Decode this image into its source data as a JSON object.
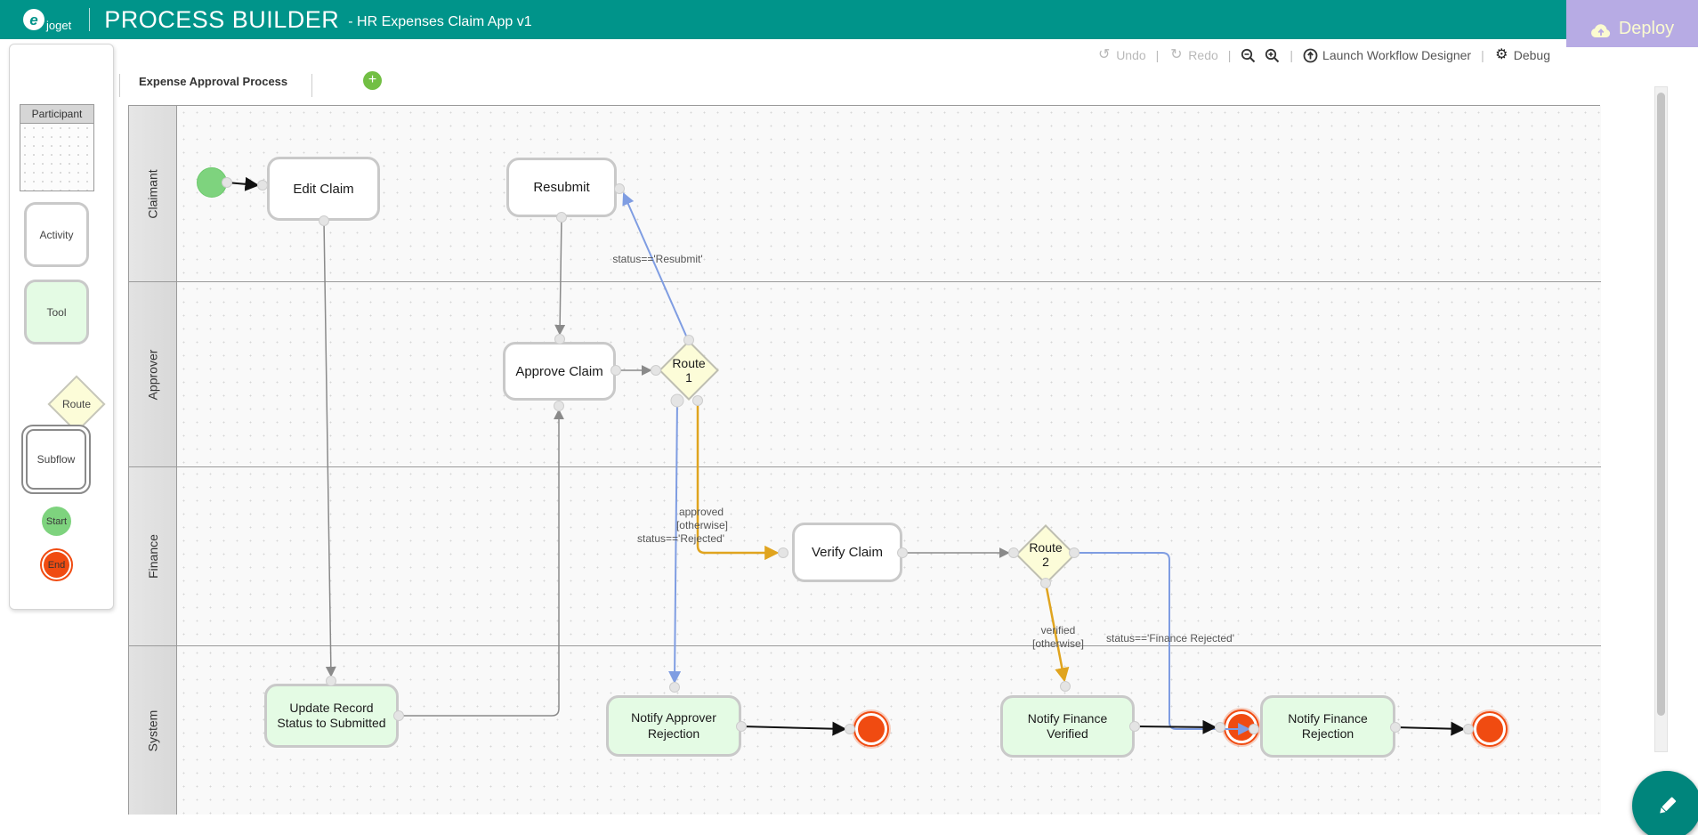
{
  "header": {
    "brand": "joget",
    "brand_mark": "e",
    "product": "PROCESS BUILDER",
    "app": "- HR Expenses Claim App v1"
  },
  "toolbar": {
    "undo": "Undo",
    "redo": "Redo",
    "launch": "Launch Workflow Designer",
    "debug": "Debug",
    "deploy": "Deploy",
    "separator": "|"
  },
  "tabs": {
    "active": "Expense Approval Process",
    "add": "+"
  },
  "palette": {
    "participant": "Participant",
    "activity": "Activity",
    "tool": "Tool",
    "route": "Route",
    "subflow": "Subflow",
    "start": "Start",
    "end": "End"
  },
  "lanes": {
    "claimant": "Claimant",
    "approver": "Approver",
    "finance": "Finance",
    "system": "System"
  },
  "diagram": {
    "nodes": {
      "edit_claim": {
        "label": "Edit Claim",
        "type": "activity"
      },
      "resubmit": {
        "label": "Resubmit",
        "type": "activity"
      },
      "approve_claim": {
        "label": "Approve Claim",
        "type": "activity"
      },
      "route1": {
        "label": "Route 1",
        "type": "route"
      },
      "verify_claim": {
        "label": "Verify Claim",
        "type": "activity"
      },
      "route2": {
        "label": "Route 2",
        "type": "route"
      },
      "update_record": {
        "label": "Update Record Status to Submitted",
        "type": "tool"
      },
      "notify_approver_rejection": {
        "label": "Notify Approver Rejection",
        "type": "tool"
      },
      "notify_finance_verified": {
        "label": "Notify Finance Verified",
        "type": "tool"
      },
      "notify_finance_rejection": {
        "label": "Notify Finance Rejection",
        "type": "tool"
      }
    },
    "edge_labels": {
      "resubmit_condition": "status=='Resubmit'",
      "approved": "approved",
      "otherwise_1": "[otherwise]",
      "rejected_condition": "status=='Rejected'",
      "verified": "verified",
      "otherwise_2": "[otherwise]",
      "finance_rejected_condition": "status=='Finance Rejected'"
    },
    "colors": {
      "header_teal": "#00948a",
      "deploy_bg": "#b7abe4",
      "deploy_text": "#fbfbd0",
      "condition_edge_blue": "#7f9de2",
      "default_edge_orange": "#e0a41f",
      "flow_edge_gray": "#8a8a8a",
      "flow_edge_black": "#111111",
      "start_green": "#7ed37e",
      "end_orange": "#f04b11",
      "tool_green": "#e4fbe4",
      "route_yellow": "#fcfcd8",
      "add_button_green": "#72bf44"
    }
  }
}
